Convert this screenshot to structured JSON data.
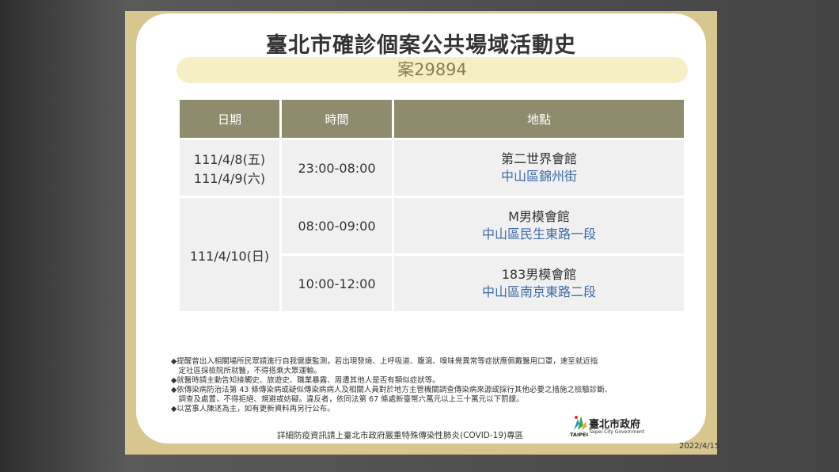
{
  "title": "臺北市確診個案公共場域活動史",
  "case_label": "案29894",
  "table": {
    "headers": {
      "date": "日期",
      "time": "時間",
      "place": "地點"
    },
    "group1": {
      "date_line1": "111/4/8(五)",
      "date_line2": "111/4/9(六)",
      "time": "23:00-08:00",
      "place_name": "第二世界會館",
      "place_area": "中山區錦州街"
    },
    "group2": {
      "date": "111/4/10(日)",
      "row1": {
        "time": "08:00-09:00",
        "place_name": "M男模會館",
        "place_area": "中山區民生東路一段"
      },
      "row2": {
        "time": "10:00-12:00",
        "place_name": "183男模會館",
        "place_area": "中山區南京東路二段"
      }
    }
  },
  "notes": {
    "n1a": "◆提醒曾出入相關場所民眾請進行自我健康監測，若出現發燒、上呼吸道、腹瀉、嗅味覺異常等症狀應佩戴醫用口罩，速至就近指",
    "n1b": "　定社區採檢院所就醫，不得搭乘大眾運輸。",
    "n2": "◆就醫時請主動告知接觸史、旅遊史、職業暴露、周遭其他人是否有類似症狀等。",
    "n3a": "◆依傳染病防治法第 43 條傳染病或疑似傳染病病人及相關人員對於地方主管機關調查傳染病來源或採行其他必要之措施之檢驗診斷、",
    "n3b": "　調查及處置，不得拒絕、規避或妨礙。違反者，依同法第 67 條處新臺幣六萬元以上三十萬元以下罰鍰。",
    "n4": "◆以當事人陳述為主，如有更新資料再另行公布。"
  },
  "footer": "詳細防疫資訊請上臺北市政府嚴重特殊傳染性肺炎(COVID-19)專區",
  "logo": {
    "zh": "臺北市政府",
    "en": "Taipei City Government",
    "taipei": "TAIPEI"
  },
  "date_stamp": "2022/4/15",
  "colors": {
    "frame": "#d8c68f",
    "header": "#8f8c6e",
    "area_text": "#3c6aa6",
    "pill": "#f6efc6"
  }
}
